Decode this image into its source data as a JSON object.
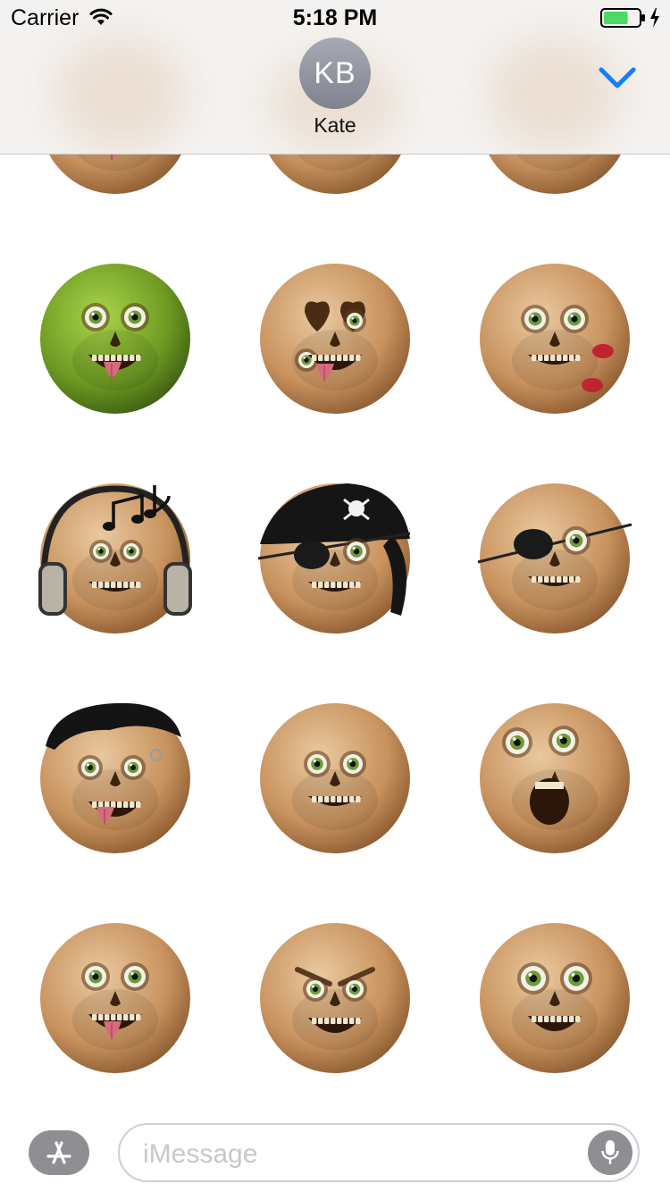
{
  "status_bar": {
    "carrier": "Carrier",
    "time": "5:18 PM",
    "battery_level": 0.7,
    "wifi_icon": "wifi-icon",
    "charging_icon": "bolt-icon"
  },
  "conversation": {
    "avatar_initials": "KB",
    "contact_name": "Kate",
    "collapse_icon": "chevron-down-icon",
    "accent_color": "#147efb"
  },
  "sticker_grid": {
    "stickers": [
      {
        "name": "skull-tongue-sticker",
        "variant": "tongue"
      },
      {
        "name": "skull-open-mouth-sticker",
        "variant": "open"
      },
      {
        "name": "skull-grin-sticker",
        "variant": "grin"
      },
      {
        "name": "green-zombie-skull-sticker",
        "variant": "zombie"
      },
      {
        "name": "heart-eyes-skull-sticker",
        "variant": "heart-eyes"
      },
      {
        "name": "kissed-skull-sticker",
        "variant": "kiss"
      },
      {
        "name": "headphones-music-skull-sticker",
        "variant": "headphones"
      },
      {
        "name": "pirate-bandana-skull-sticker",
        "variant": "pirate"
      },
      {
        "name": "eyepatch-skull-sticker",
        "variant": "eyepatch"
      },
      {
        "name": "punk-hair-skull-sticker",
        "variant": "punk"
      },
      {
        "name": "smiling-skull-sticker",
        "variant": "smile"
      },
      {
        "name": "shocked-skull-sticker",
        "variant": "shocked"
      },
      {
        "name": "tongue-out-skull-sticker",
        "variant": "tongue-2"
      },
      {
        "name": "angry-grin-skull-sticker",
        "variant": "angry"
      },
      {
        "name": "wide-eyed-skull-sticker",
        "variant": "wide"
      }
    ]
  },
  "input_bar": {
    "appstore_icon": "app-store-icon",
    "placeholder": "iMessage",
    "mic_icon": "microphone-icon"
  }
}
